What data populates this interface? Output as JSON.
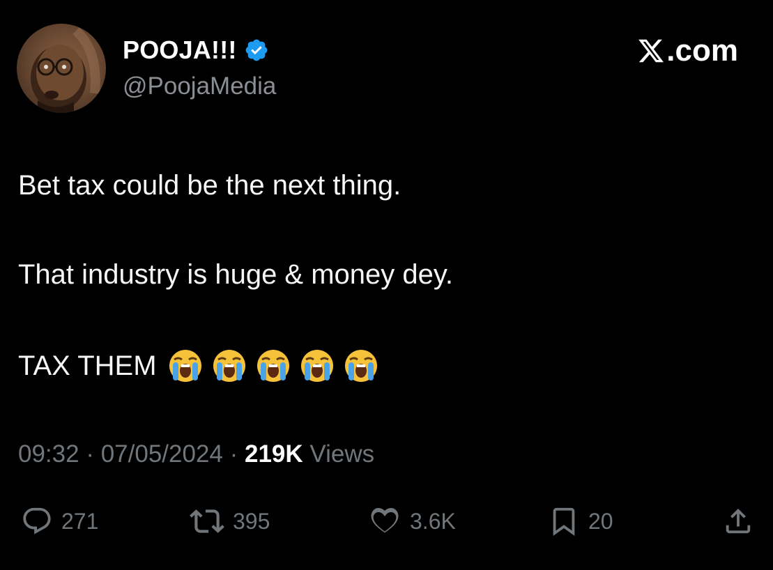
{
  "header": {
    "display_name": "POOJA!!!",
    "handle": "@PoojaMedia",
    "verified": true,
    "site": ".com",
    "site_logo_icon": "x-logo-icon",
    "avatar_icon": "avatar"
  },
  "tweet": {
    "lines": [
      "Bet tax could be the next thing.",
      "That industry is huge & money dey.",
      "TAX THEM"
    ],
    "emojis": [
      "loudly-crying-face-icon",
      "loudly-crying-face-icon",
      "loudly-crying-face-icon",
      "loudly-crying-face-icon",
      "loudly-crying-face-icon"
    ]
  },
  "meta": {
    "time": "09:32",
    "sep1": " · ",
    "date": "07/05/2024",
    "sep2": " · ",
    "views_count": "219K",
    "views_label": " Views"
  },
  "actions": {
    "replies": "271",
    "reposts": "395",
    "likes": "3.6K",
    "bookmarks": "20"
  },
  "colors": {
    "background": "#000000",
    "text_primary": "#e7e9ea",
    "text_secondary": "#71767b",
    "verified_blue": "#1d9bf0"
  }
}
